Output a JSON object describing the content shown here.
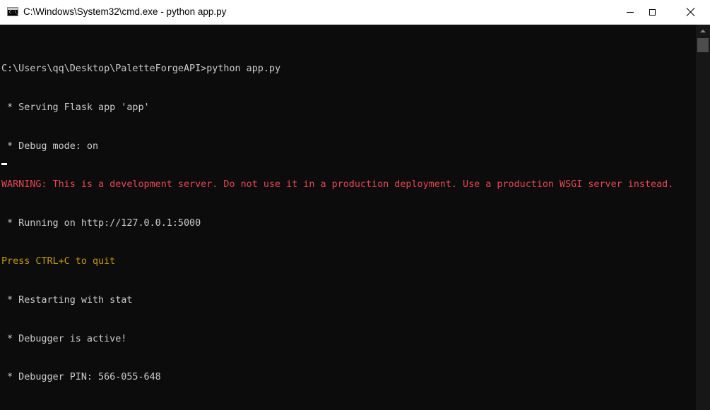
{
  "window": {
    "title": "C:\\Windows\\System32\\cmd.exe - python  app.py",
    "icon_name": "cmd-icon",
    "icon_prompt": "C:\\_",
    "controls": {
      "minimize": "minimize-icon",
      "maximize": "maximize-icon",
      "close": "close-icon"
    }
  },
  "console": {
    "background": "#0c0c0c",
    "default_color": "#cccccc",
    "warning_color": "#e74856",
    "notice_color": "#c19c00",
    "lines": [
      "C:\\Users\\qq\\Desktop\\PaletteForgeAPI>python app.py",
      " * Serving Flask app 'app'",
      " * Debug mode: on",
      "WARNING: This is a development server. Do not use it in a production deployment. Use a production WSGI server instead.",
      " * Running on http://127.0.0.1:5000",
      "Press CTRL+C to quit",
      " * Restarting with stat",
      " * Debugger is active!",
      " * Debugger PIN: 566-055-648"
    ]
  }
}
